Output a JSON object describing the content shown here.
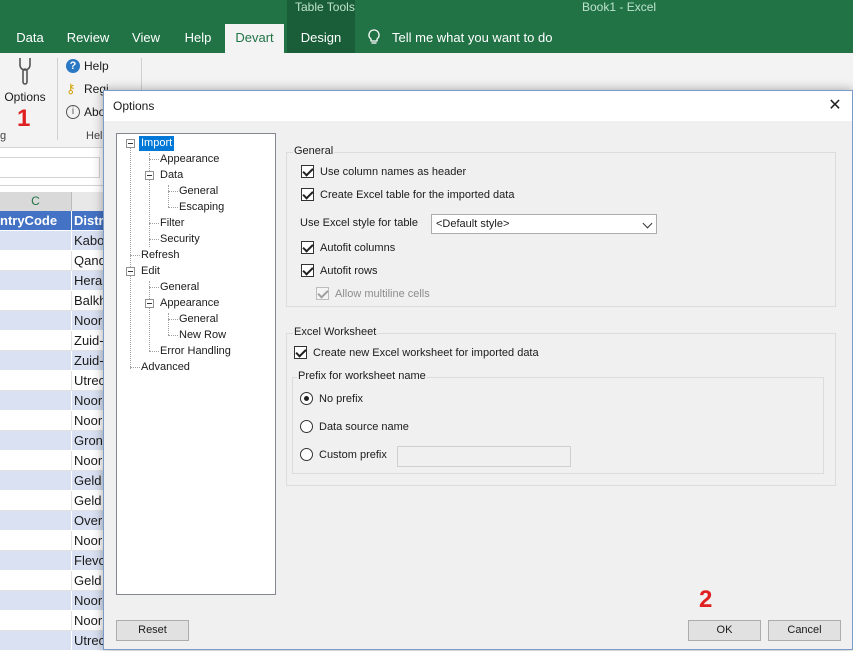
{
  "excel": {
    "context_tab": "Table Tools",
    "doc_title": "Book1  -  Excel",
    "tabs": [
      {
        "label": "Data",
        "active": false
      },
      {
        "label": "Review",
        "active": false
      },
      {
        "label": "View",
        "active": false
      },
      {
        "label": "Help",
        "active": false
      },
      {
        "label": "Devart",
        "active": true
      },
      {
        "label": "Design",
        "active": false
      }
    ],
    "tell_me": "Tell me what you want to do",
    "ribbon": {
      "options_label": "Options",
      "help_label": "Help",
      "register_label": "Regi",
      "about_label": "Abo",
      "group_label_left": "g",
      "group_label_help": "Hel"
    },
    "column_c": "C",
    "table_header": {
      "c": "ntryCode",
      "d": "Distr"
    },
    "rows_d": [
      "Kabo",
      "Qand",
      "Hera",
      "Balkh",
      "Noor",
      "Zuid-",
      "Zuid-",
      "Utrec",
      "Noor",
      "Noor",
      "Gron",
      "Noor",
      "Geld",
      "Geld",
      "Over",
      "Noor",
      "Flevo",
      "Geld",
      "Noor",
      "Noor",
      "Utrec"
    ]
  },
  "annotations": {
    "badge_1": "1",
    "badge_2": "2"
  },
  "dialog": {
    "title": "Options",
    "close": "✕",
    "tree": [
      "Import",
      "Appearance",
      "Data",
      "General",
      "Escaping",
      "Filter",
      "Security",
      "Refresh",
      "Edit",
      "General",
      "Appearance",
      "General",
      "New Row",
      "Error Handling",
      "Advanced"
    ],
    "general": {
      "legend": "General",
      "use_column_names": {
        "label": "Use column names as header",
        "checked": true
      },
      "create_table": {
        "label": "Create Excel table for the imported data",
        "checked": true
      },
      "style_label": "Use Excel style for table",
      "style_value": "<Default style>",
      "autofit_columns": {
        "label": "Autofit columns",
        "checked": true
      },
      "autofit_rows": {
        "label": "Autofit rows",
        "checked": true
      },
      "allow_multiline": {
        "label": "Allow multiline cells",
        "checked": true,
        "enabled": false
      }
    },
    "worksheet": {
      "legend": "Excel Worksheet",
      "create_new": {
        "label": "Create new Excel worksheet for imported data",
        "checked": true
      },
      "prefix_legend": "Prefix for worksheet name",
      "no_prefix": "No prefix",
      "data_source_name": "Data source name",
      "custom_prefix": "Custom prefix",
      "selected": "No prefix",
      "custom_prefix_value": ""
    },
    "buttons": {
      "reset": "Reset",
      "ok": "OK",
      "cancel": "Cancel"
    }
  }
}
